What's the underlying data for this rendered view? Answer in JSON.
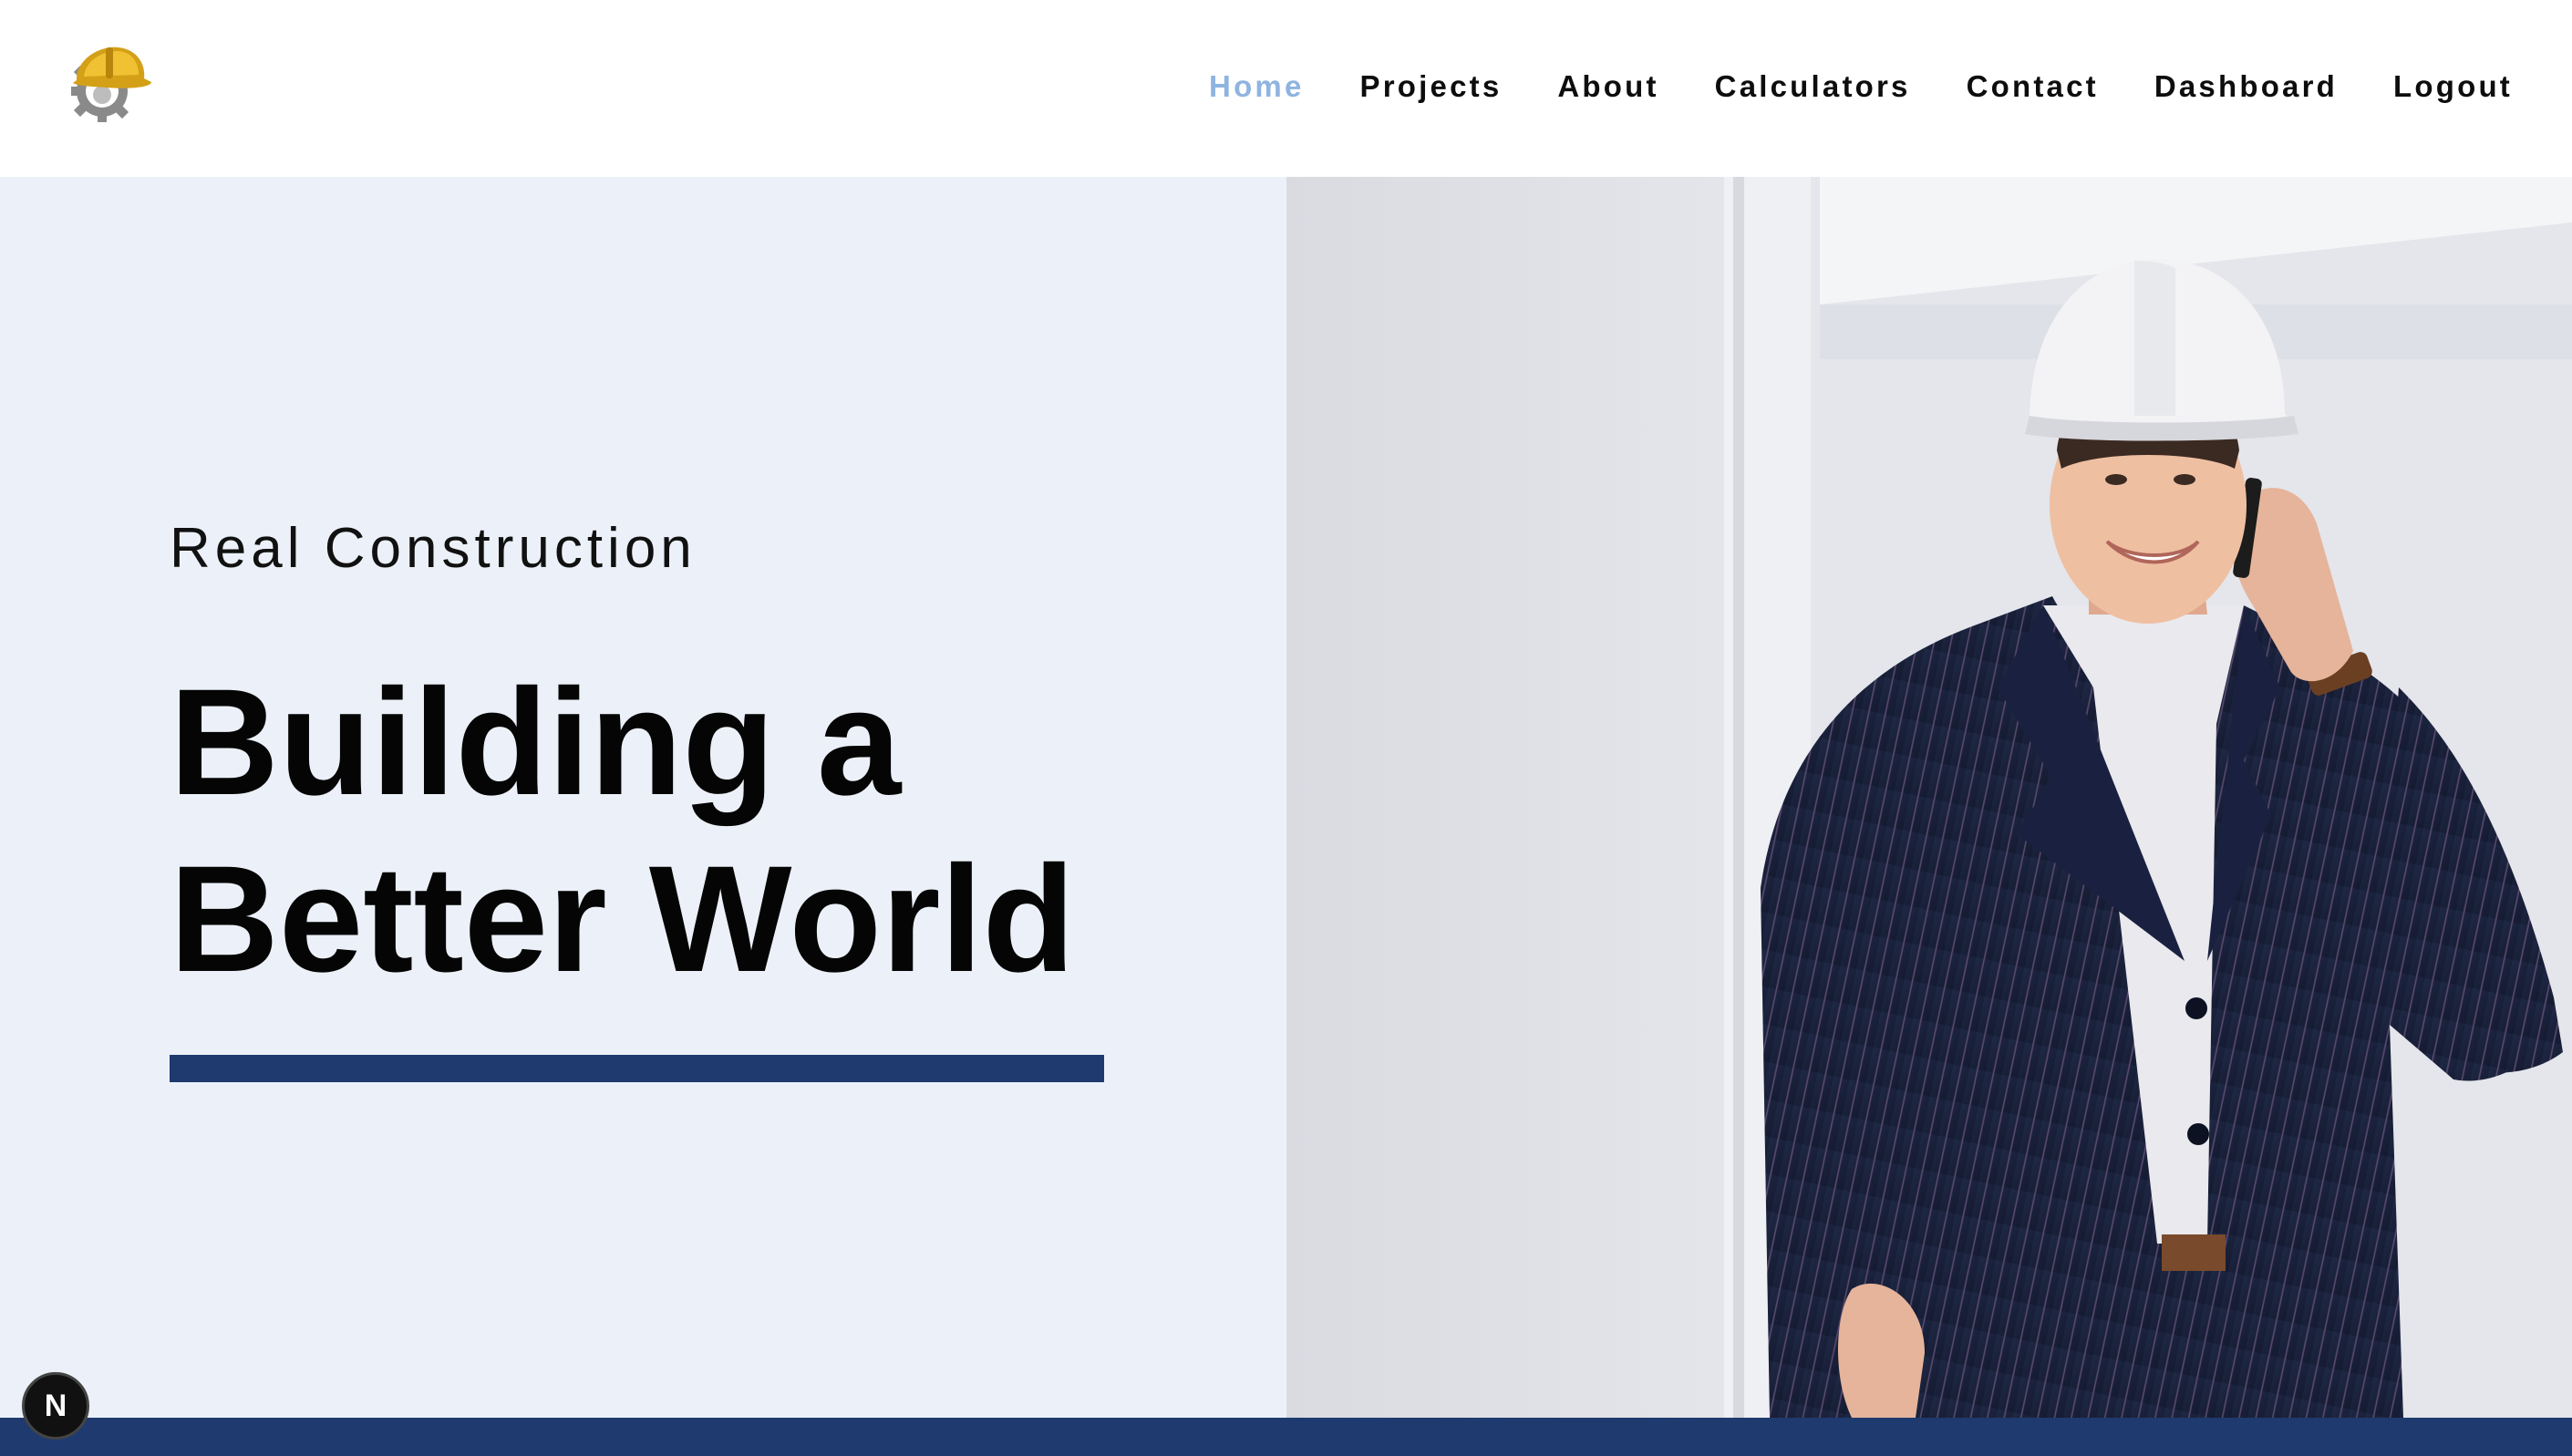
{
  "header": {
    "logo_icon": "hardhat-gear-logo-icon",
    "nav": [
      {
        "label": "Home",
        "active": true
      },
      {
        "label": "Projects",
        "active": false
      },
      {
        "label": "About",
        "active": false
      },
      {
        "label": "Calculators",
        "active": false
      },
      {
        "label": "Contact",
        "active": false
      },
      {
        "label": "Dashboard",
        "active": false
      },
      {
        "label": "Logout",
        "active": false
      }
    ]
  },
  "hero": {
    "eyebrow": "Real Construction",
    "headline_line1": "Building a",
    "headline_line2": "Better World",
    "image": "engineer-with-hardhat-on-phone-photo"
  },
  "badge": {
    "letter": "N",
    "icon": "nextjs-dev-indicator-icon"
  },
  "colors": {
    "nav_active": "#8fb4e0",
    "accent_navy": "#1e3a6e",
    "hero_bg": "#ecf1f9",
    "text": "#050505"
  }
}
